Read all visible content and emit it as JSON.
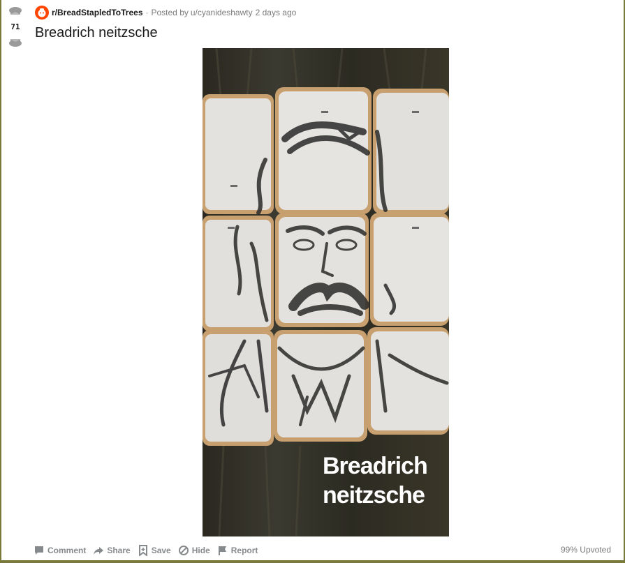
{
  "vote": {
    "score": "71"
  },
  "post": {
    "subreddit": "r/BreadStapledToTrees",
    "meta_separator": "·",
    "posted_by_label": "Posted by",
    "username": "u/cyanideshawty",
    "timestamp": "2 days ago",
    "title": "Breadrich neitzsche",
    "image_caption_line1": "Breadrich",
    "image_caption_line2": "neitzsche"
  },
  "actions": {
    "comment": "Comment",
    "share": "Share",
    "save": "Save",
    "hide": "Hide",
    "report": "Report"
  },
  "upvote_ratio": "99% Upvoted",
  "icons": {
    "upvote": "bread-upvote-icon",
    "downvote": "bread-downvote-icon",
    "subreddit": "subreddit-avatar-icon",
    "comment": "comment-icon",
    "share": "share-arrow-icon",
    "save": "bookmark-icon",
    "hide": "hide-circle-icon",
    "report": "flag-icon"
  },
  "colors": {
    "accent": "#ff4500",
    "meta_text": "#7c7c7c",
    "action_text": "#878a8c",
    "title_text": "#1a1a1b",
    "border": "#7a7a3a"
  }
}
